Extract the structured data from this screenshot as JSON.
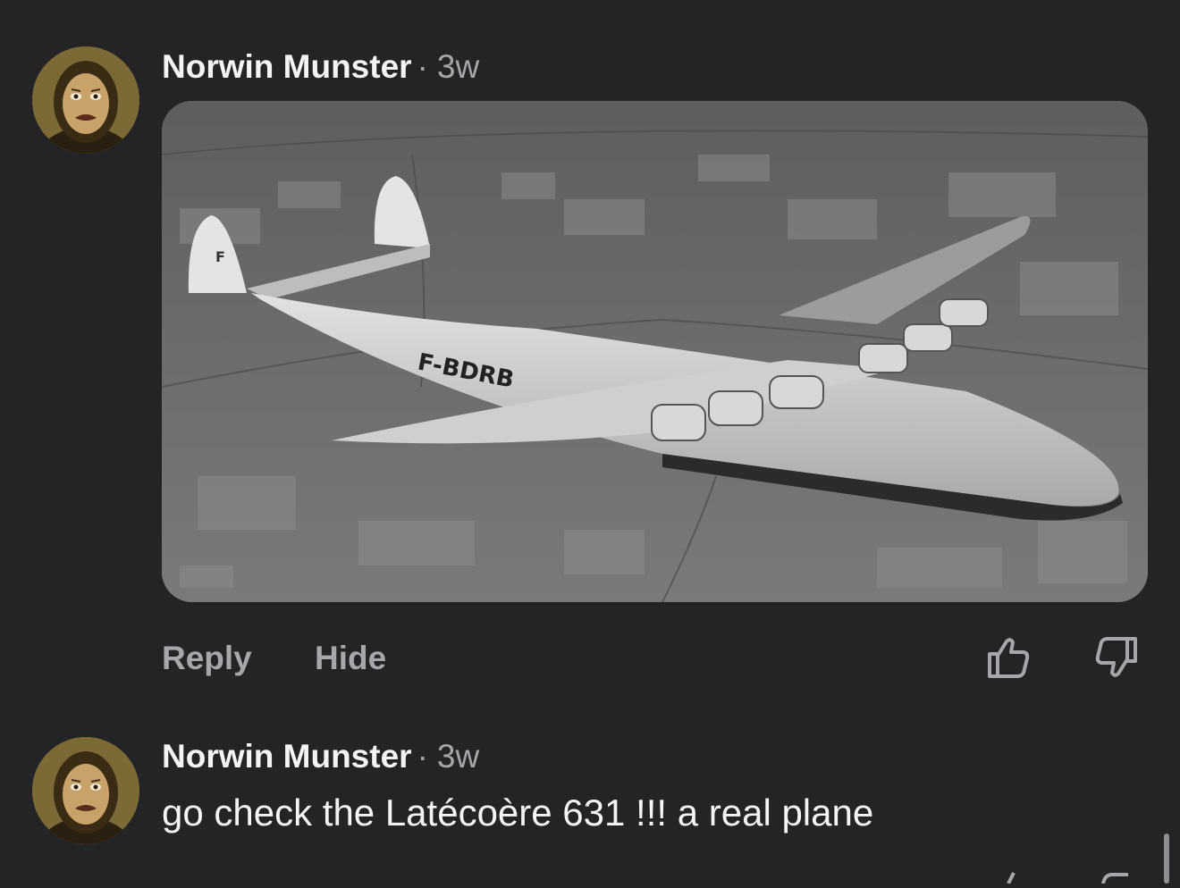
{
  "comments": [
    {
      "author": "Norwin Munster",
      "separator": "·",
      "time": "3w",
      "avatar_icon": "portrait-avatar-icon",
      "image": {
        "kind": "photo",
        "description_icon": "flying-boat-photo",
        "registration": "F-BDRB"
      },
      "actions": {
        "reply": "Reply",
        "hide": "Hide"
      },
      "vote_icons": [
        "thumbs-up-icon",
        "thumbs-down-icon"
      ]
    },
    {
      "author": "Norwin Munster",
      "separator": "·",
      "time": "3w",
      "avatar_icon": "portrait-avatar-icon",
      "text": "go check the Latécoère 631 !!! a real plane"
    }
  ],
  "colors": {
    "background": "#242426",
    "primary_text": "#f4f4f4",
    "secondary_text": "#a5a5aa"
  }
}
